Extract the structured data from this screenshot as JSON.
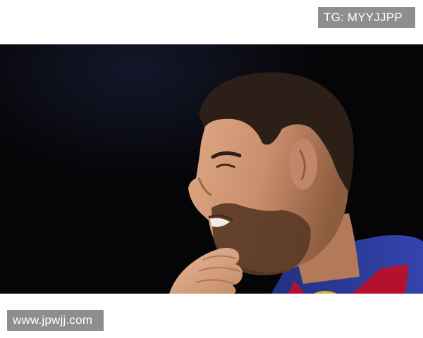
{
  "watermarks": {
    "top": "TG: MYYJJPP",
    "bottom": "www.jpwjj.com"
  },
  "photo": {
    "subject": "footballer-portrait"
  },
  "colors": {
    "background": "#ffffff",
    "photo_background": "#050507",
    "watermark_bg": "#8e8e8e",
    "watermark_text": "#ffffff",
    "jersey_blue": "#2a3a9a",
    "jersey_red": "#b3122e",
    "skin": "#c98f6c",
    "hair": "#2b1f18",
    "beard": "#5a3a26"
  }
}
